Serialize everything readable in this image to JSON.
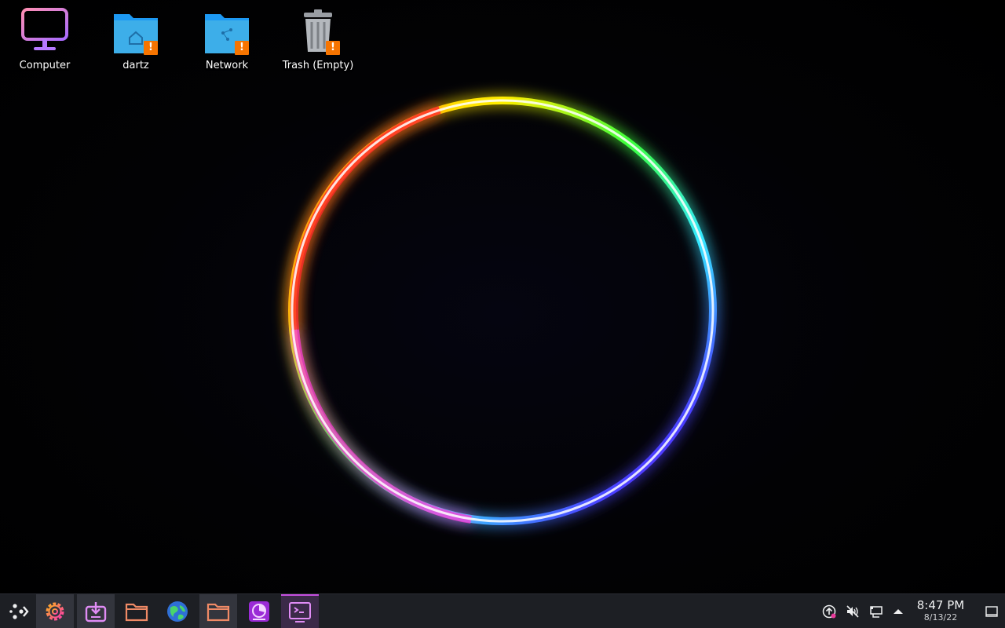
{
  "desktop": {
    "icons": [
      {
        "label": "Computer"
      },
      {
        "label": "dartz"
      },
      {
        "label": "Network"
      },
      {
        "label": "Trash (Empty)"
      }
    ],
    "badge_glyph": "!"
  },
  "taskbar": {
    "launcher_icon": "application-launcher-icon",
    "tasks": [
      {
        "icon": "system-settings-icon",
        "state": "active"
      },
      {
        "icon": "discover-store-icon",
        "state": "active"
      },
      {
        "icon": "folder-icon",
        "state": "normal"
      },
      {
        "icon": "web-browser-globe-icon",
        "state": "normal"
      },
      {
        "icon": "folder-icon",
        "state": "active"
      },
      {
        "icon": "disk-usage-icon",
        "state": "normal"
      },
      {
        "icon": "terminal-icon",
        "state": "focused"
      }
    ]
  },
  "tray": {
    "icons": [
      "update-notifier-icon",
      "volume-muted-icon",
      "network-wired-icon",
      "expand-arrow-icon"
    ],
    "time": "8:47 PM",
    "date": "8/13/22",
    "show_desktop_icon": "show-desktop-icon"
  },
  "colors": {
    "taskbar_bg": "#1d1f24",
    "accent": "#c64fe0",
    "folder_blue": "#3daee9",
    "warning_orange": "#f67400"
  }
}
